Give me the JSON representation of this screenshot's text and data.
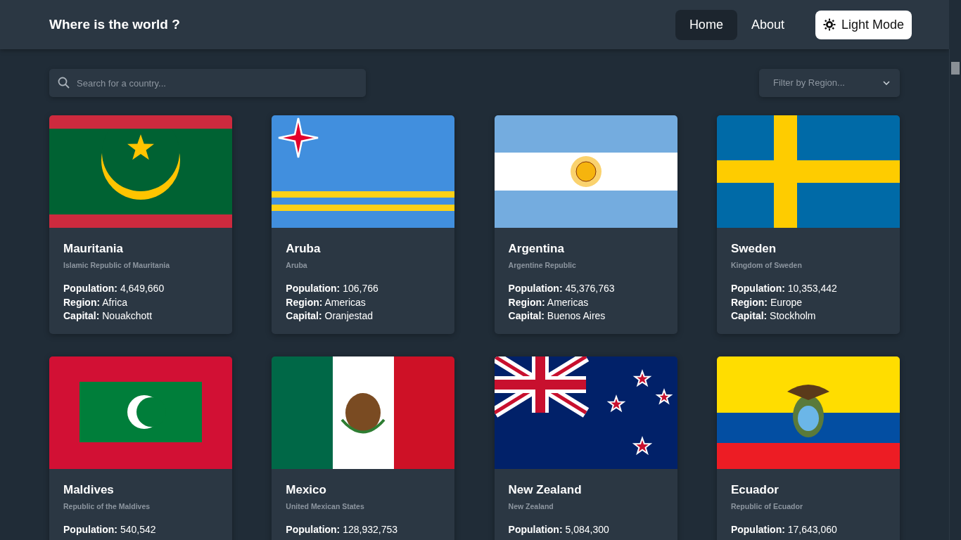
{
  "header": {
    "title": "Where is the world ?",
    "nav": [
      {
        "label": "Home",
        "selected": true
      },
      {
        "label": "About",
        "selected": false
      }
    ],
    "theme_button": "Light Mode"
  },
  "search": {
    "placeholder": "Search for a country..."
  },
  "filter": {
    "placeholder": "Filter by Region..."
  },
  "countries": [
    {
      "name": "Mauritania",
      "official_name": "Islamic Republic of Mauritania",
      "details": [
        {
          "label": "Population:",
          "value": "4,649,660"
        },
        {
          "label": "Region:",
          "value": "Africa"
        },
        {
          "label": "Capital:",
          "value": "Nouakchott"
        }
      ]
    },
    {
      "name": "Aruba",
      "official_name": "Aruba",
      "details": [
        {
          "label": "Population:",
          "value": "106,766"
        },
        {
          "label": "Region:",
          "value": "Americas"
        },
        {
          "label": "Capital:",
          "value": "Oranjestad"
        }
      ]
    },
    {
      "name": "Argentina",
      "official_name": "Argentine Republic",
      "details": [
        {
          "label": "Population:",
          "value": "45,376,763"
        },
        {
          "label": "Region:",
          "value": "Americas"
        },
        {
          "label": "Capital:",
          "value": "Buenos Aires"
        }
      ]
    },
    {
      "name": "Sweden",
      "official_name": "Kingdom of Sweden",
      "details": [
        {
          "label": "Population:",
          "value": "10,353,442"
        },
        {
          "label": "Region:",
          "value": "Europe"
        },
        {
          "label": "Capital:",
          "value": "Stockholm"
        }
      ]
    },
    {
      "name": "Maldives",
      "official_name": "Republic of the Maldives",
      "details": [
        {
          "label": "Population:",
          "value": "540,542"
        }
      ]
    },
    {
      "name": "Mexico",
      "official_name": "United Mexican States",
      "details": [
        {
          "label": "Population:",
          "value": "128,932,753"
        }
      ]
    },
    {
      "name": "New Zealand",
      "official_name": "New Zealand",
      "details": [
        {
          "label": "Population:",
          "value": "5,084,300"
        }
      ]
    },
    {
      "name": "Ecuador",
      "official_name": "Republic of Ecuador",
      "details": [
        {
          "label": "Population:",
          "value": "17,643,060"
        }
      ]
    }
  ]
}
